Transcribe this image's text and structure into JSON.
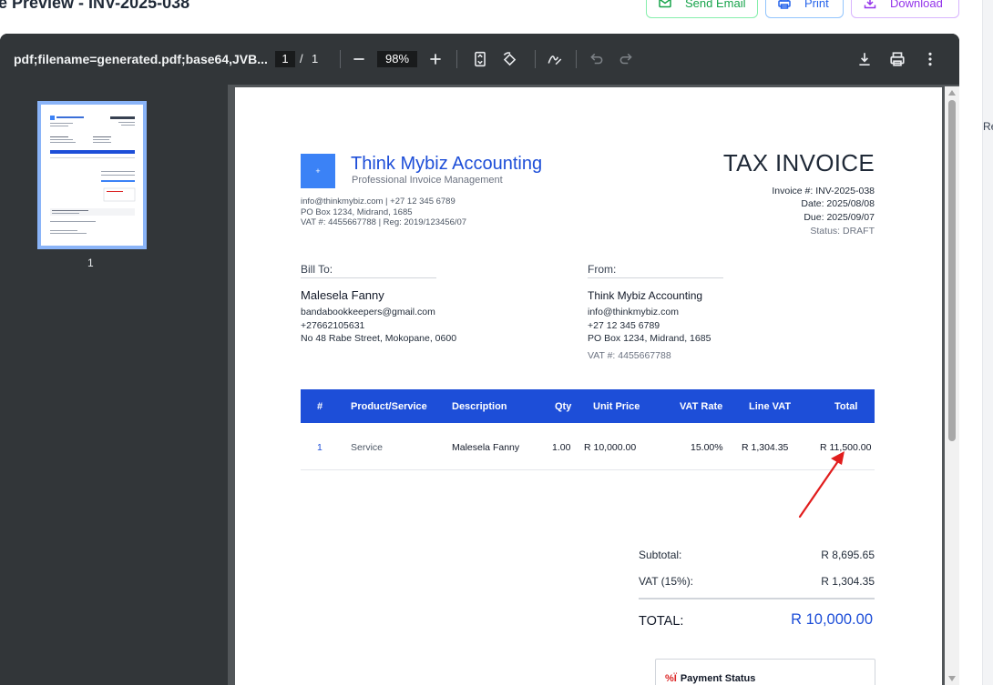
{
  "header": {
    "title": "e Preview - INV-2025-038",
    "send_email": "Send Email",
    "print": "Print",
    "download": "Download",
    "right_fragment": "Re"
  },
  "toolbar": {
    "filename": "pdf;filename=generated.pdf;base64,JVB...",
    "page_current": "1",
    "page_slash": "/",
    "page_total": "1",
    "zoom": "98%"
  },
  "sidebar": {
    "thumb_page": "1"
  },
  "invoice": {
    "logo_text": "+",
    "company": "Think Mybiz Accounting",
    "tagline": "Professional Invoice Management",
    "contact": "info@thinkmybiz.com | +27 12 345 6789",
    "address": "PO Box 1234, Midrand, 1685",
    "vat_reg": "VAT #: 4455667788 | Reg: 2019/123456/07",
    "title": "TAX INVOICE",
    "number": "Invoice #: INV-2025-038",
    "date": "Date: 2025/08/08",
    "due": "Due: 2025/09/07",
    "status": "Status: DRAFT",
    "bill_to_label": "Bill To:",
    "bill_name": "Malesela Fanny",
    "bill_email": "bandabookkeepers@gmail.com",
    "bill_phone": "+27662105631",
    "bill_address": "No 48 Rabe Street, Mokopane, 0600",
    "from_label": "From:",
    "from_name": "Think Mybiz Accounting",
    "from_email": "info@thinkmybiz.com",
    "from_phone": "+27 12 345 6789",
    "from_address": "PO Box 1234, Midrand, 1685",
    "from_vat": "VAT #: 4455667788",
    "columns": [
      "#",
      "Product/Service",
      "Description",
      "Qty",
      "Unit Price",
      "VAT Rate",
      "Line VAT",
      "Total"
    ],
    "rows": [
      {
        "num": "1",
        "product": "Service",
        "description": "Malesela Fanny",
        "qty": "1.00",
        "unit_price": "R 10,000.00",
        "vat_rate": "15.00%",
        "line_vat": "R 1,304.35",
        "total": "R 11,500.00"
      }
    ],
    "subtotal_label": "Subtotal:",
    "subtotal": "R 8,695.65",
    "vat_label": "VAT (15%):",
    "vat": "R 1,304.35",
    "total_label": "TOTAL:",
    "total": "R 10,000.00",
    "payment_icon": "%Ï",
    "payment_title": "Payment Status"
  },
  "colors": {
    "accent": "#1d4ed8",
    "annotation_arrow": "#e11d1d"
  }
}
